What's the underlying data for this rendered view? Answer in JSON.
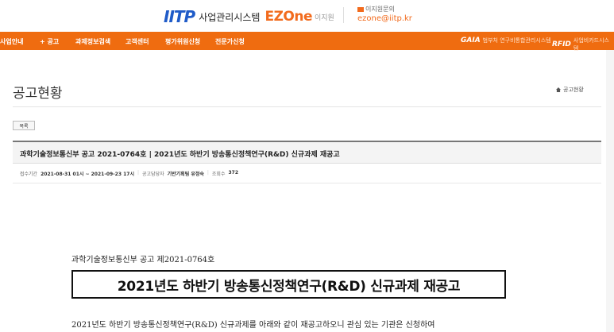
{
  "header": {
    "logo_iitp": "IITP",
    "logo_system": "사업관리시스템",
    "logo_ezone": "EZOne",
    "logo_ezone_sub": "이지원",
    "contact_title": "이지원문의",
    "contact_email": "ezone@iitp.kr"
  },
  "nav": {
    "items": [
      {
        "label": "사업안내"
      },
      {
        "label": "+ 공고"
      },
      {
        "label": "과제정보검색"
      },
      {
        "label": "고객센터"
      },
      {
        "label": "평가위원신청"
      },
      {
        "label": "전문가신청"
      }
    ],
    "gaia_logo": "GAIA",
    "gaia_text": "범부처 연구비통합관리시스템",
    "rfid_logo": "RFID",
    "rfid_text": "사업비카드시스템"
  },
  "page": {
    "title": "공고현황",
    "breadcrumb": "공고현황",
    "list_button": "목록"
  },
  "notice": {
    "title": "과학기술정보통신부 공고 2021-0764호 | 2021년도 하반기 방송통신정책연구(R&D) 신규과제 재공고",
    "period_label": "접수기간",
    "period_value": "2021-08-31 01시 ~ 2021-09-23 17시",
    "dept_label": "공고담당자",
    "dept_value": "기반기획팀 유정숙",
    "views_label": "조회수",
    "views_value": "372"
  },
  "document": {
    "ministry_line": "과학기술정보통신부 공고 제2021-0764호",
    "headline": "2021년도 하반기 방송통신정책연구(R&D) 신규과제 재공고",
    "paragraph": "2021년도 하반기 방송통신정책연구(R&D) 신규과제를 아래와 같이 재공고하오니 관심 있는 기관은 신청하여"
  },
  "colors": {
    "accent_orange": "#ef6c10",
    "brand_blue": "#1f5bc8"
  }
}
